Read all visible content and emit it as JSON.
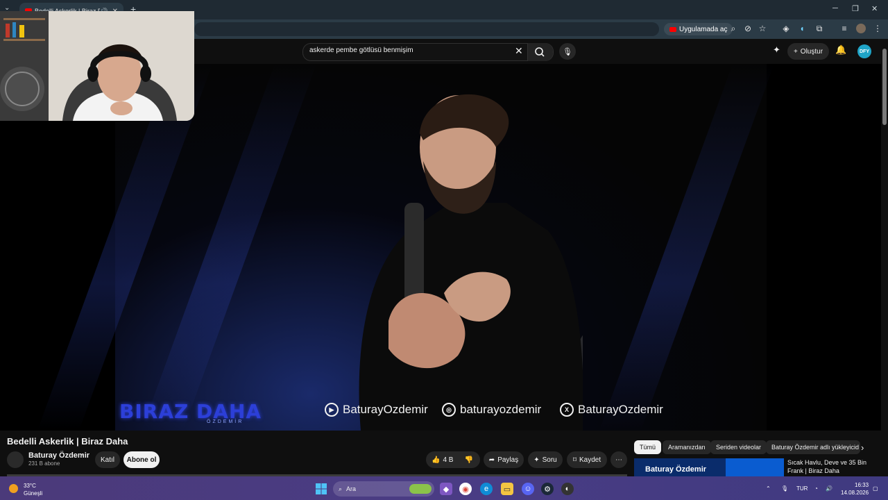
{
  "browser": {
    "tab_title": "Bedelli Askerlik | Biraz Daha",
    "open_in_app": "Uygulamada aç"
  },
  "youtube": {
    "search_query": "askerde pembe götlüsü benmişim",
    "create_label": "Oluştur",
    "account_initials": "DFY"
  },
  "video": {
    "logo": "BIRAZ DAHA",
    "logo_sub": "ÖZDEMİR",
    "social": [
      {
        "icon": "youtube-icon",
        "handle": "BaturayOzdemir"
      },
      {
        "icon": "instagram-icon",
        "handle": "baturayozdemir"
      },
      {
        "icon": "x-icon",
        "handle": "BaturayOzdemir"
      }
    ]
  },
  "watch": {
    "title": "Bedelli Askerlik | Biraz Daha",
    "channel": "Baturay Özdemir",
    "subscribers": "231 B abone",
    "join": "Katıl",
    "subscribe": "Abone ol",
    "likes": "4 B",
    "share": "Paylaş",
    "ask": "Soru",
    "save": "Kaydet"
  },
  "chips": [
    "Tümü",
    "Aramanızdan",
    "Seriden videolar",
    "Baturay Özdemir adlı yükleyicid"
  ],
  "recommendation": {
    "thumb_text": "Baturay Özdemir",
    "title": "Sıcak Havlu, Deve ve 35 Bin Frank | Biraz Daha"
  },
  "taskbar": {
    "temperature": "33°C",
    "weather": "Güneşli",
    "search_placeholder": "Ara",
    "language": "TUR",
    "time": "16:33",
    "date": "14.08.2026"
  }
}
